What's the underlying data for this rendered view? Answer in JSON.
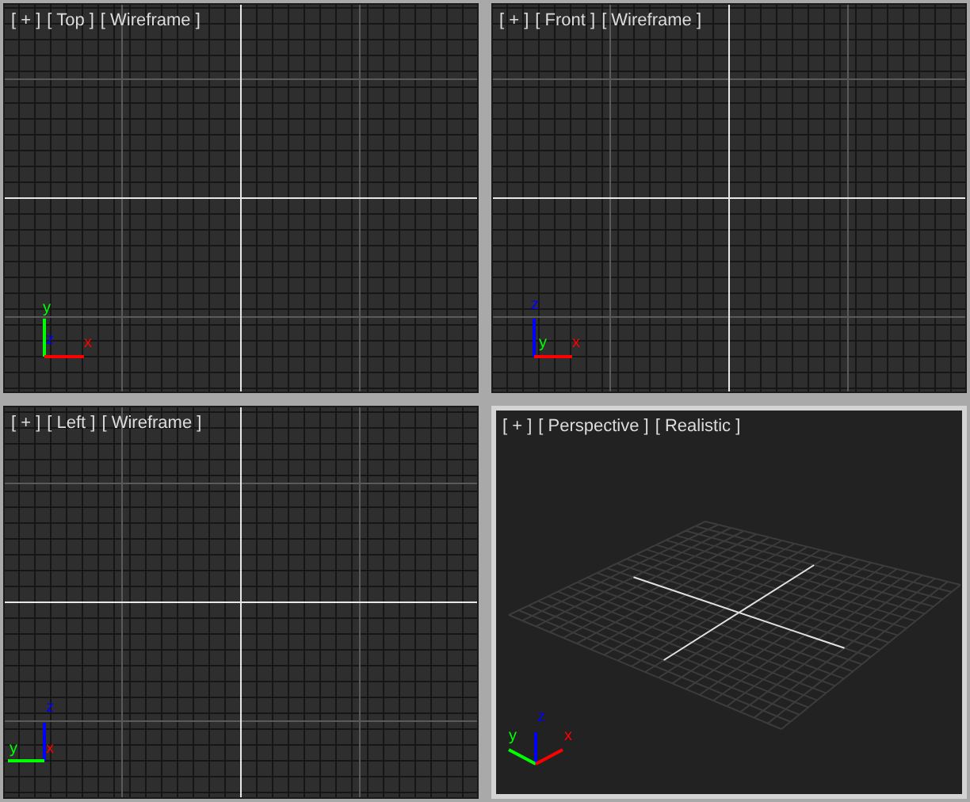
{
  "viewports": [
    {
      "kind": "top",
      "selected": false,
      "menu": "[ + ]",
      "view_label": "[ Top ]",
      "shading_label": "[ Wireframe ]",
      "axes": [
        {
          "label": "y",
          "color": "#00ff00"
        },
        {
          "label": "z",
          "color": "#0000ff"
        },
        {
          "label": "x",
          "color": "#ff0000"
        }
      ]
    },
    {
      "kind": "front",
      "selected": false,
      "menu": "[ + ]",
      "view_label": "[ Front ]",
      "shading_label": "[ Wireframe ]",
      "axes": [
        {
          "label": "z",
          "color": "#0000ff"
        },
        {
          "label": "y",
          "color": "#00ff00"
        },
        {
          "label": "x",
          "color": "#ff0000"
        }
      ]
    },
    {
      "kind": "left",
      "selected": false,
      "menu": "[ + ]",
      "view_label": "[ Left ]",
      "shading_label": "[ Wireframe ]",
      "axes": [
        {
          "label": "z",
          "color": "#0000ff"
        },
        {
          "label": "y",
          "color": "#00ff00"
        },
        {
          "label": "x",
          "color": "#ff0000"
        }
      ]
    },
    {
      "kind": "perspective",
      "selected": true,
      "menu": "[ + ]",
      "view_label": "[ Perspective ]",
      "shading_label": "[ Realistic ]",
      "axes": [
        {
          "label": "z",
          "color": "#0000ff"
        },
        {
          "label": "y",
          "color": "#00ff00"
        },
        {
          "label": "x",
          "color": "#ff0000"
        }
      ]
    }
  ]
}
